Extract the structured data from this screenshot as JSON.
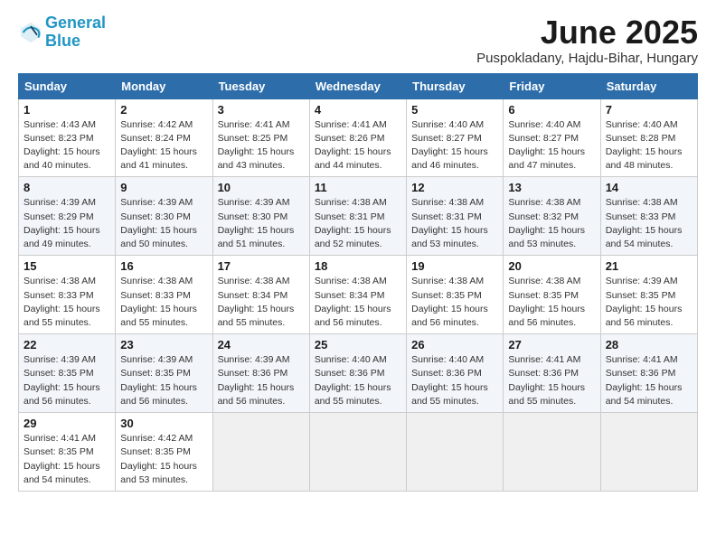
{
  "header": {
    "logo_line1": "General",
    "logo_line2": "Blue",
    "month": "June 2025",
    "location": "Puspokladany, Hajdu-Bihar, Hungary"
  },
  "days_of_week": [
    "Sunday",
    "Monday",
    "Tuesday",
    "Wednesday",
    "Thursday",
    "Friday",
    "Saturday"
  ],
  "weeks": [
    [
      {
        "day": 1,
        "info": "Sunrise: 4:43 AM\nSunset: 8:23 PM\nDaylight: 15 hours\nand 40 minutes."
      },
      {
        "day": 2,
        "info": "Sunrise: 4:42 AM\nSunset: 8:24 PM\nDaylight: 15 hours\nand 41 minutes."
      },
      {
        "day": 3,
        "info": "Sunrise: 4:41 AM\nSunset: 8:25 PM\nDaylight: 15 hours\nand 43 minutes."
      },
      {
        "day": 4,
        "info": "Sunrise: 4:41 AM\nSunset: 8:26 PM\nDaylight: 15 hours\nand 44 minutes."
      },
      {
        "day": 5,
        "info": "Sunrise: 4:40 AM\nSunset: 8:27 PM\nDaylight: 15 hours\nand 46 minutes."
      },
      {
        "day": 6,
        "info": "Sunrise: 4:40 AM\nSunset: 8:27 PM\nDaylight: 15 hours\nand 47 minutes."
      },
      {
        "day": 7,
        "info": "Sunrise: 4:40 AM\nSunset: 8:28 PM\nDaylight: 15 hours\nand 48 minutes."
      }
    ],
    [
      {
        "day": 8,
        "info": "Sunrise: 4:39 AM\nSunset: 8:29 PM\nDaylight: 15 hours\nand 49 minutes."
      },
      {
        "day": 9,
        "info": "Sunrise: 4:39 AM\nSunset: 8:30 PM\nDaylight: 15 hours\nand 50 minutes."
      },
      {
        "day": 10,
        "info": "Sunrise: 4:39 AM\nSunset: 8:30 PM\nDaylight: 15 hours\nand 51 minutes."
      },
      {
        "day": 11,
        "info": "Sunrise: 4:38 AM\nSunset: 8:31 PM\nDaylight: 15 hours\nand 52 minutes."
      },
      {
        "day": 12,
        "info": "Sunrise: 4:38 AM\nSunset: 8:31 PM\nDaylight: 15 hours\nand 53 minutes."
      },
      {
        "day": 13,
        "info": "Sunrise: 4:38 AM\nSunset: 8:32 PM\nDaylight: 15 hours\nand 53 minutes."
      },
      {
        "day": 14,
        "info": "Sunrise: 4:38 AM\nSunset: 8:33 PM\nDaylight: 15 hours\nand 54 minutes."
      }
    ],
    [
      {
        "day": 15,
        "info": "Sunrise: 4:38 AM\nSunset: 8:33 PM\nDaylight: 15 hours\nand 55 minutes."
      },
      {
        "day": 16,
        "info": "Sunrise: 4:38 AM\nSunset: 8:33 PM\nDaylight: 15 hours\nand 55 minutes."
      },
      {
        "day": 17,
        "info": "Sunrise: 4:38 AM\nSunset: 8:34 PM\nDaylight: 15 hours\nand 55 minutes."
      },
      {
        "day": 18,
        "info": "Sunrise: 4:38 AM\nSunset: 8:34 PM\nDaylight: 15 hours\nand 56 minutes."
      },
      {
        "day": 19,
        "info": "Sunrise: 4:38 AM\nSunset: 8:35 PM\nDaylight: 15 hours\nand 56 minutes."
      },
      {
        "day": 20,
        "info": "Sunrise: 4:38 AM\nSunset: 8:35 PM\nDaylight: 15 hours\nand 56 minutes."
      },
      {
        "day": 21,
        "info": "Sunrise: 4:39 AM\nSunset: 8:35 PM\nDaylight: 15 hours\nand 56 minutes."
      }
    ],
    [
      {
        "day": 22,
        "info": "Sunrise: 4:39 AM\nSunset: 8:35 PM\nDaylight: 15 hours\nand 56 minutes."
      },
      {
        "day": 23,
        "info": "Sunrise: 4:39 AM\nSunset: 8:35 PM\nDaylight: 15 hours\nand 56 minutes."
      },
      {
        "day": 24,
        "info": "Sunrise: 4:39 AM\nSunset: 8:36 PM\nDaylight: 15 hours\nand 56 minutes."
      },
      {
        "day": 25,
        "info": "Sunrise: 4:40 AM\nSunset: 8:36 PM\nDaylight: 15 hours\nand 55 minutes."
      },
      {
        "day": 26,
        "info": "Sunrise: 4:40 AM\nSunset: 8:36 PM\nDaylight: 15 hours\nand 55 minutes."
      },
      {
        "day": 27,
        "info": "Sunrise: 4:41 AM\nSunset: 8:36 PM\nDaylight: 15 hours\nand 55 minutes."
      },
      {
        "day": 28,
        "info": "Sunrise: 4:41 AM\nSunset: 8:36 PM\nDaylight: 15 hours\nand 54 minutes."
      }
    ],
    [
      {
        "day": 29,
        "info": "Sunrise: 4:41 AM\nSunset: 8:35 PM\nDaylight: 15 hours\nand 54 minutes."
      },
      {
        "day": 30,
        "info": "Sunrise: 4:42 AM\nSunset: 8:35 PM\nDaylight: 15 hours\nand 53 minutes."
      },
      null,
      null,
      null,
      null,
      null
    ]
  ]
}
